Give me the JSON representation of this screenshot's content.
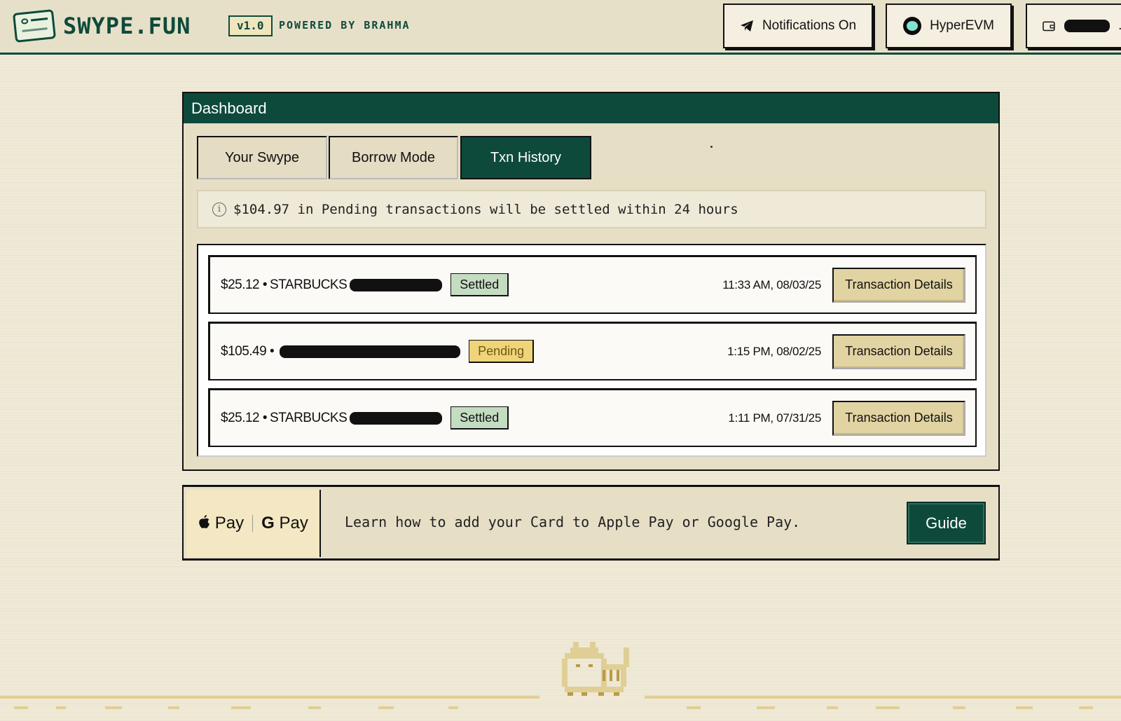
{
  "header": {
    "brand": "SWYPE.FUN",
    "version": "v1.0",
    "powered": "POWERED BY BRAHMA",
    "notifications_label": "Notifications On",
    "chain_label": "HyperEVM",
    "wallet_suffix": "..."
  },
  "dashboard": {
    "title": "Dashboard",
    "tabs": [
      {
        "label": "Your Swype"
      },
      {
        "label": "Borrow Mode"
      },
      {
        "label": "Txn History"
      }
    ],
    "info": "$104.97 in Pending transactions will be settled within 24 hours",
    "transactions": [
      {
        "amount": "$25.12 •",
        "merchant": "STARBUCKS",
        "status": "Settled",
        "time": "11:33 AM, 08/03/25",
        "details_label": "Transaction Details"
      },
      {
        "amount": "$105.49 •",
        "merchant": "",
        "status": "Pending",
        "time": "1:15 PM, 08/02/25",
        "details_label": "Transaction Details"
      },
      {
        "amount": "$25.12 •",
        "merchant": "STARBUCKS",
        "status": "Settled",
        "time": "1:11 PM, 07/31/25",
        "details_label": "Transaction Details"
      }
    ]
  },
  "paybar": {
    "apple_pay": "Pay",
    "google_pay": "Pay",
    "text": "Learn how to add your Card to Apple Pay or Google Pay.",
    "guide_label": "Guide"
  },
  "colors": {
    "primary": "#0e4a3c",
    "background": "#efe9d6",
    "settled": "#c4ddc2",
    "pending": "#f0d479"
  }
}
